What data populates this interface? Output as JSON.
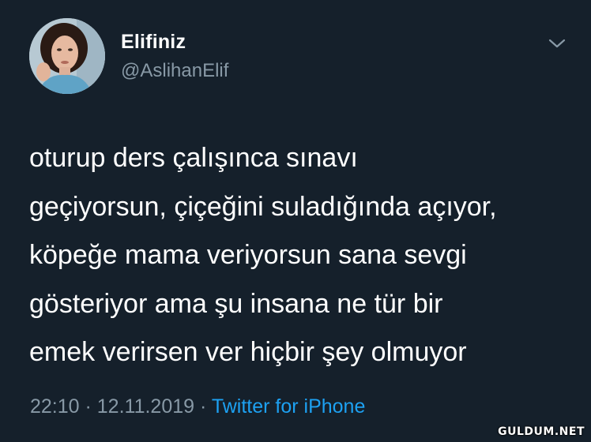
{
  "user": {
    "display_name": "Elifiniz",
    "handle": "@AslihanElif"
  },
  "tweet": {
    "text": "oturup ders çalışınca sınavı\ngeçiyorsun, çiçeğini suladığında açıyor,\nköpeğe mama veriyorsun sana sevgi\ngösteriyor ama şu insana ne tür bir\nemek verirsen ver hiçbir şey olmuyor"
  },
  "meta": {
    "time": "22:10",
    "separator": " · ",
    "date": "12.11.2019",
    "source": "Twitter for iPhone"
  },
  "icons": {
    "more": "chevron-down-icon",
    "avatar": "user-avatar"
  },
  "watermark": "GULDUM.NET",
  "colors": {
    "background": "#15202b",
    "text": "#ffffff",
    "secondary": "#8899a6",
    "accent": "#1da1f2"
  }
}
